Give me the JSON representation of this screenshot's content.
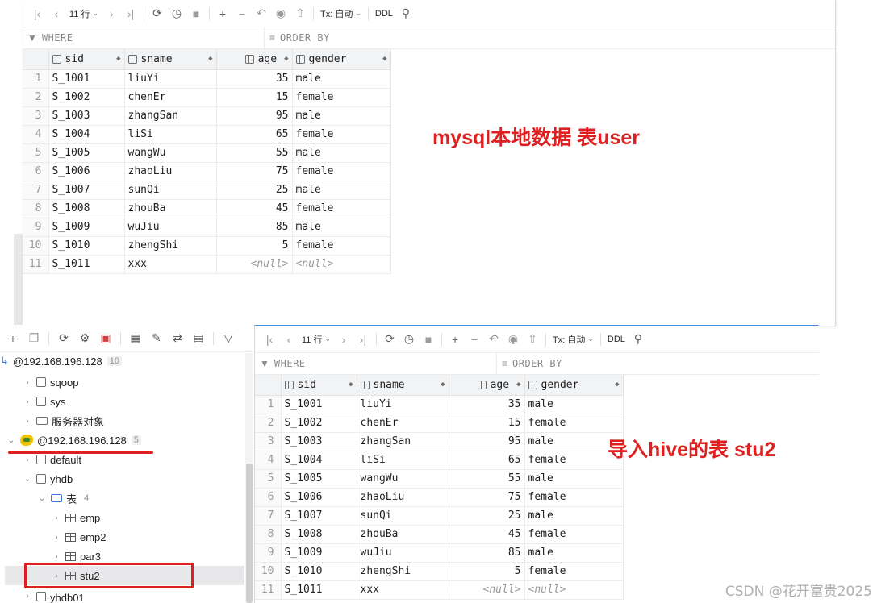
{
  "top_panel": {
    "toolbar": {
      "rows_label": "11 行",
      "tx_label": "Tx: 自动",
      "ddl_label": "DDL"
    },
    "filter": {
      "where_label": "WHERE",
      "order_label": "ORDER BY"
    },
    "columns": [
      "sid",
      "sname",
      "age",
      "gender"
    ],
    "rows": [
      {
        "n": "1",
        "sid": "S_1001",
        "sname": "liuYi",
        "age": "35",
        "gender": "male"
      },
      {
        "n": "2",
        "sid": "S_1002",
        "sname": "chenEr",
        "age": "15",
        "gender": "female"
      },
      {
        "n": "3",
        "sid": "S_1003",
        "sname": "zhangSan",
        "age": "95",
        "gender": "male"
      },
      {
        "n": "4",
        "sid": "S_1004",
        "sname": "liSi",
        "age": "65",
        "gender": "female"
      },
      {
        "n": "5",
        "sid": "S_1005",
        "sname": "wangWu",
        "age": "55",
        "gender": "male"
      },
      {
        "n": "6",
        "sid": "S_1006",
        "sname": "zhaoLiu",
        "age": "75",
        "gender": "female"
      },
      {
        "n": "7",
        "sid": "S_1007",
        "sname": "sunQi",
        "age": "25",
        "gender": "male"
      },
      {
        "n": "8",
        "sid": "S_1008",
        "sname": "zhouBa",
        "age": "45",
        "gender": "female"
      },
      {
        "n": "9",
        "sid": "S_1009",
        "sname": "wuJiu",
        "age": "85",
        "gender": "male"
      },
      {
        "n": "10",
        "sid": "S_1010",
        "sname": "zhengShi",
        "age": "5",
        "gender": "female"
      },
      {
        "n": "11",
        "sid": "S_1011",
        "sname": "xxx",
        "age": "<null>",
        "gender": "<null>"
      }
    ],
    "annotation": "mysql本地数据 表user"
  },
  "bottom_panel": {
    "toolbar": {
      "rows_label": "11 行",
      "tx_label": "Tx: 自动",
      "ddl_label": "DDL"
    },
    "filter": {
      "where_label": "WHERE",
      "order_label": "ORDER BY"
    },
    "columns": [
      "sid",
      "sname",
      "age",
      "gender"
    ],
    "rows": [
      {
        "n": "1",
        "sid": "S_1001",
        "sname": "liuYi",
        "age": "35",
        "gender": "male"
      },
      {
        "n": "2",
        "sid": "S_1002",
        "sname": "chenEr",
        "age": "15",
        "gender": "female"
      },
      {
        "n": "3",
        "sid": "S_1003",
        "sname": "zhangSan",
        "age": "95",
        "gender": "male"
      },
      {
        "n": "4",
        "sid": "S_1004",
        "sname": "liSi",
        "age": "65",
        "gender": "female"
      },
      {
        "n": "5",
        "sid": "S_1005",
        "sname": "wangWu",
        "age": "55",
        "gender": "male"
      },
      {
        "n": "6",
        "sid": "S_1006",
        "sname": "zhaoLiu",
        "age": "75",
        "gender": "female"
      },
      {
        "n": "7",
        "sid": "S_1007",
        "sname": "sunQi",
        "age": "25",
        "gender": "male"
      },
      {
        "n": "8",
        "sid": "S_1008",
        "sname": "zhouBa",
        "age": "45",
        "gender": "female"
      },
      {
        "n": "9",
        "sid": "S_1009",
        "sname": "wuJiu",
        "age": "85",
        "gender": "male"
      },
      {
        "n": "10",
        "sid": "S_1010",
        "sname": "zhengShi",
        "age": "5",
        "gender": "female"
      },
      {
        "n": "11",
        "sid": "S_1011",
        "sname": "xxx",
        "age": "<null>",
        "gender": "<null>"
      }
    ],
    "annotation": "导入hive的表 stu2"
  },
  "tree": {
    "mysql_conn": {
      "label": "@192.168.196.128",
      "count": "10"
    },
    "mysql_children": [
      "sqoop",
      "sys",
      "服务器对象"
    ],
    "hive_conn": {
      "label": "@192.168.196.128",
      "count": "5"
    },
    "default_db": "default",
    "yhdb": "yhdb",
    "tables_folder": {
      "label": "表",
      "count": "4"
    },
    "tables": [
      "emp",
      "emp2",
      "par3",
      "stu2"
    ],
    "cut_item": "yhdb01"
  },
  "colors": {
    "annotation_red": "#e02020",
    "highlight_box": "#e02020",
    "accent_blue": "#3b7ddd"
  },
  "watermark": "CSDN @花开富贵2025"
}
